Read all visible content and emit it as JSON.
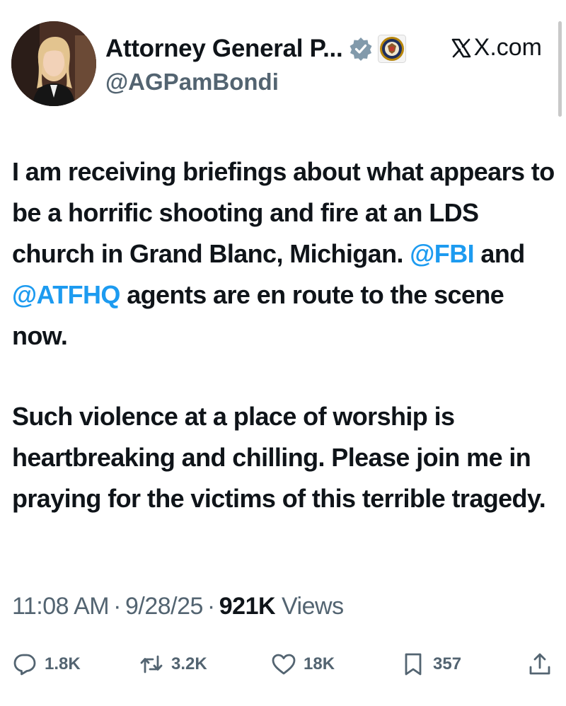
{
  "author": {
    "display_name": "Attorney General P...",
    "handle": "@AGPamBondi",
    "verified_badge": "verified-checkmark-icon",
    "affiliation_badge": "doj-seal-icon",
    "source": "X.com"
  },
  "tweet": {
    "p1_text1": "I am receiving briefings about what appears to be a horrific shooting and fire at an LDS church in Grand Blanc, Michigan. ",
    "mention1": "@FBI",
    "p1_text2": " and ",
    "mention2": "@ATFHQ",
    "p1_text3": " agents are en route to the scene now.",
    "p2_text": "Such violence at a place of worship is heartbreaking and chilling. Please join me in praying for the victims of this terrible tragedy."
  },
  "meta": {
    "time": "11:08 AM",
    "date": "9/28/25",
    "views_count": "921K",
    "views_label": "Views",
    "separator": "·"
  },
  "actions": {
    "replies": "1.8K",
    "reposts": "3.2K",
    "likes": "18K",
    "bookmarks": "357"
  },
  "colors": {
    "text": "#0f1419",
    "secondary": "#536471",
    "link": "#1d9bf0"
  }
}
